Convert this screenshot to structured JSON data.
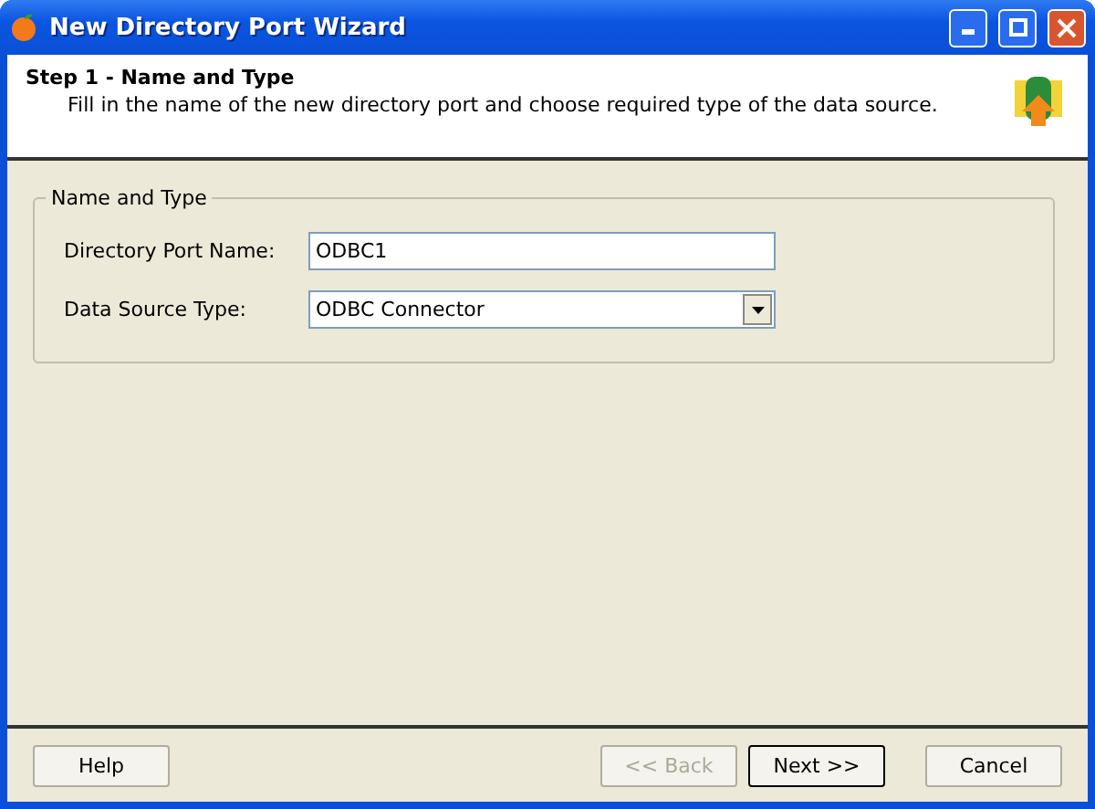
{
  "window": {
    "title": "New Directory Port Wizard"
  },
  "header": {
    "title": "Step 1 - Name and Type",
    "description": "Fill in the name of the new directory port and choose required type of the data source."
  },
  "group": {
    "title": "Name and Type",
    "fields": [
      {
        "kind": "text",
        "label": "Directory Port Name:",
        "value": "ODBC1"
      },
      {
        "kind": "select",
        "label": "Data Source Type:",
        "value": "ODBC Connector"
      }
    ]
  },
  "buttons": [
    {
      "label": "Help",
      "disabled": false,
      "default": false
    },
    {
      "label": "<< Back",
      "disabled": true,
      "default": false
    },
    {
      "label": "Next >>",
      "disabled": false,
      "default": true
    },
    {
      "label": "Cancel",
      "disabled": false,
      "default": false
    }
  ]
}
